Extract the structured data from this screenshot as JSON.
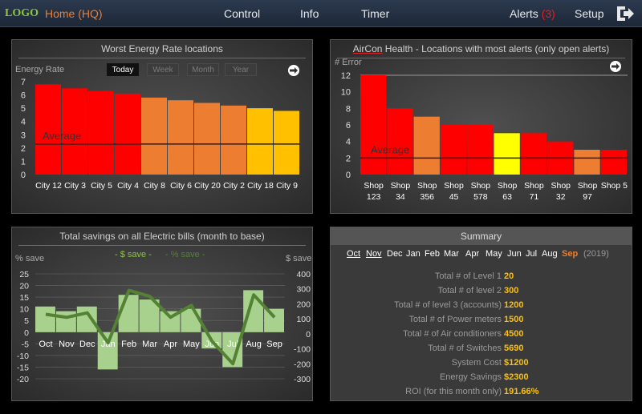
{
  "header": {
    "logo": "LOGO",
    "home": "Home (HQ)",
    "nav": [
      "Control",
      "Info",
      "Timer"
    ],
    "alerts_label": "Alerts",
    "alerts_count": "(3)",
    "setup": "Setup"
  },
  "energy_panel": {
    "title": "Worst Energy Rate locations",
    "y_label": "Energy Rate",
    "ranges": [
      "Today",
      "Week",
      "Month",
      "Year"
    ],
    "active_range": "Today",
    "average_label": "Average"
  },
  "aircon_panel": {
    "title_underlined": "AirCon",
    "title_rest": " Health - Locations with most alerts (only open alerts)",
    "y_label": "# Error",
    "average_label": "Average"
  },
  "savings_panel": {
    "title": "Total savings on all Electric bills (month to base)",
    "y_left_label": "% save",
    "y_right_label": "$ save",
    "legend_dollar": "- $ save -",
    "legend_percent": "- % save -"
  },
  "summary_panel": {
    "title": "Summary",
    "months": [
      "Oct",
      "Nov",
      "Dec",
      "Jan",
      "Feb",
      "Mar",
      "Apr",
      "May",
      "Jun",
      "Jul",
      "Aug",
      "Sep"
    ],
    "active_month": "Sep",
    "year": "(2019)",
    "stats": [
      {
        "label": "Total # of Level 1",
        "value": "20"
      },
      {
        "label": "Total # of level 2",
        "value": "300"
      },
      {
        "label": "Total # of level 3 (accounts)",
        "value": "1200"
      },
      {
        "label": "Total # of Power meters",
        "value": "1500"
      },
      {
        "label": "Total # of Air conditioners",
        "value": "4500"
      },
      {
        "label": "Total # of Switches",
        "value": "5690"
      },
      {
        "label": "System Cost",
        "value": "$1200"
      },
      {
        "label": "Energy Savings",
        "value": "$2300"
      },
      {
        "label": "ROI (for this month only)",
        "value": "191.66%"
      }
    ]
  },
  "colors": {
    "red": "#ff0000",
    "orange": "#ed7d31",
    "amber": "#ffc000",
    "yellow": "#ffff00",
    "green_bar": "#a9d18e",
    "green_line": "#548235"
  },
  "chart_data": [
    {
      "type": "bar",
      "title": "Worst Energy Rate locations",
      "ylabel": "Energy Rate",
      "ylim": [
        0,
        7
      ],
      "categories": [
        "City 12",
        "City 3",
        "City 5",
        "City 4",
        "City 8",
        "City 6",
        "City 20",
        "City 2",
        "City 18",
        "City 9"
      ],
      "values": [
        6.8,
        6.5,
        6.3,
        6.1,
        5.8,
        5.6,
        5.4,
        5.2,
        5.0,
        4.8
      ],
      "bar_colors": [
        "#ff0000",
        "#ff0000",
        "#ff0000",
        "#ff0000",
        "#ed7d31",
        "#ed7d31",
        "#ed7d31",
        "#ed7d31",
        "#ffc000",
        "#ffc000"
      ],
      "average": 2.3
    },
    {
      "type": "bar",
      "title": "AirCon Health - Locations with most alerts (only open alerts)",
      "ylabel": "# Error",
      "ylim": [
        0,
        12
      ],
      "categories": [
        [
          "Shop",
          "123"
        ],
        [
          "Shop",
          "34"
        ],
        [
          "Shop",
          "356"
        ],
        [
          "Shop",
          "45"
        ],
        [
          "Shop",
          "578"
        ],
        [
          "Shop",
          "63"
        ],
        [
          "Shop",
          "71"
        ],
        [
          "Shop",
          "32"
        ],
        [
          "Shop",
          "97"
        ],
        [
          "Shop 5"
        ]
      ],
      "values": [
        12,
        8,
        7,
        6,
        6,
        5,
        5,
        4,
        3,
        3
      ],
      "bar_colors": [
        "#ff0000",
        "#ff0000",
        "#ed7d31",
        "#ff0000",
        "#ff0000",
        "#ffff00",
        "#ff0000",
        "#ff0000",
        "#ed7d31",
        "#ff0000"
      ],
      "average": 2
    },
    {
      "type": "bar",
      "title": "Total savings on all Electric bills (month to base)",
      "categories": [
        "Oct",
        "Nov",
        "Dec",
        "Jan",
        "Feb",
        "Mar",
        "Apr",
        "May",
        "Jun",
        "Jul",
        "Aug",
        "Sep"
      ],
      "series": [
        {
          "name": "% save",
          "type": "bar",
          "axis": "left",
          "values": [
            11,
            9,
            11,
            -16,
            16,
            14,
            9,
            10,
            -7,
            -15,
            18,
            10
          ]
        },
        {
          "name": "$ save",
          "type": "line",
          "axis": "right",
          "values": [
            130,
            110,
            140,
            -60,
            290,
            250,
            110,
            190,
            -50,
            -200,
            260,
            110
          ]
        }
      ],
      "ylim_left": [
        -20,
        25
      ],
      "ylim_right": [
        -300,
        400
      ],
      "left_ticks": [
        25,
        20,
        15,
        10,
        5,
        0,
        -5,
        -10,
        -15,
        -20
      ],
      "right_ticks": [
        400,
        300,
        200,
        100,
        0,
        -100,
        -200,
        -300
      ]
    }
  ]
}
